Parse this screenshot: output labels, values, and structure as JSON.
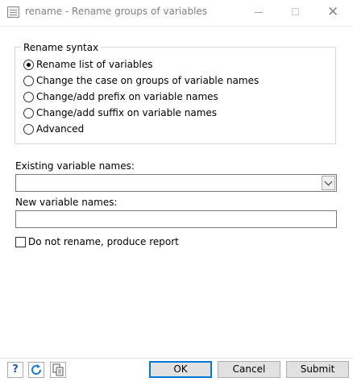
{
  "window": {
    "title": "rename - Rename groups of variables",
    "app_icon": "stata-dialog-icon"
  },
  "rename_syntax": {
    "legend": "Rename syntax",
    "options": [
      {
        "label": "Rename list of variables",
        "checked": true
      },
      {
        "label": "Change the case on groups of variable names",
        "checked": false
      },
      {
        "label": "Change/add prefix on variable names",
        "checked": false
      },
      {
        "label": "Change/add suffix on variable names",
        "checked": false
      },
      {
        "label": "Advanced",
        "checked": false
      }
    ]
  },
  "existing": {
    "label": "Existing variable names:",
    "value": ""
  },
  "new_names": {
    "label": "New variable names:",
    "value": ""
  },
  "report_option": {
    "label": "Do not rename, produce report",
    "checked": false
  },
  "buttons": {
    "ok": "OK",
    "cancel": "Cancel",
    "submit": "Submit"
  },
  "icons": {
    "help": "help-icon",
    "reset": "reset-icon",
    "copy": "copy-command-icon"
  },
  "colors": {
    "accent": "#0078d7",
    "help_icon": "#2b5aa8",
    "reset_icon": "#1f7ac7"
  }
}
